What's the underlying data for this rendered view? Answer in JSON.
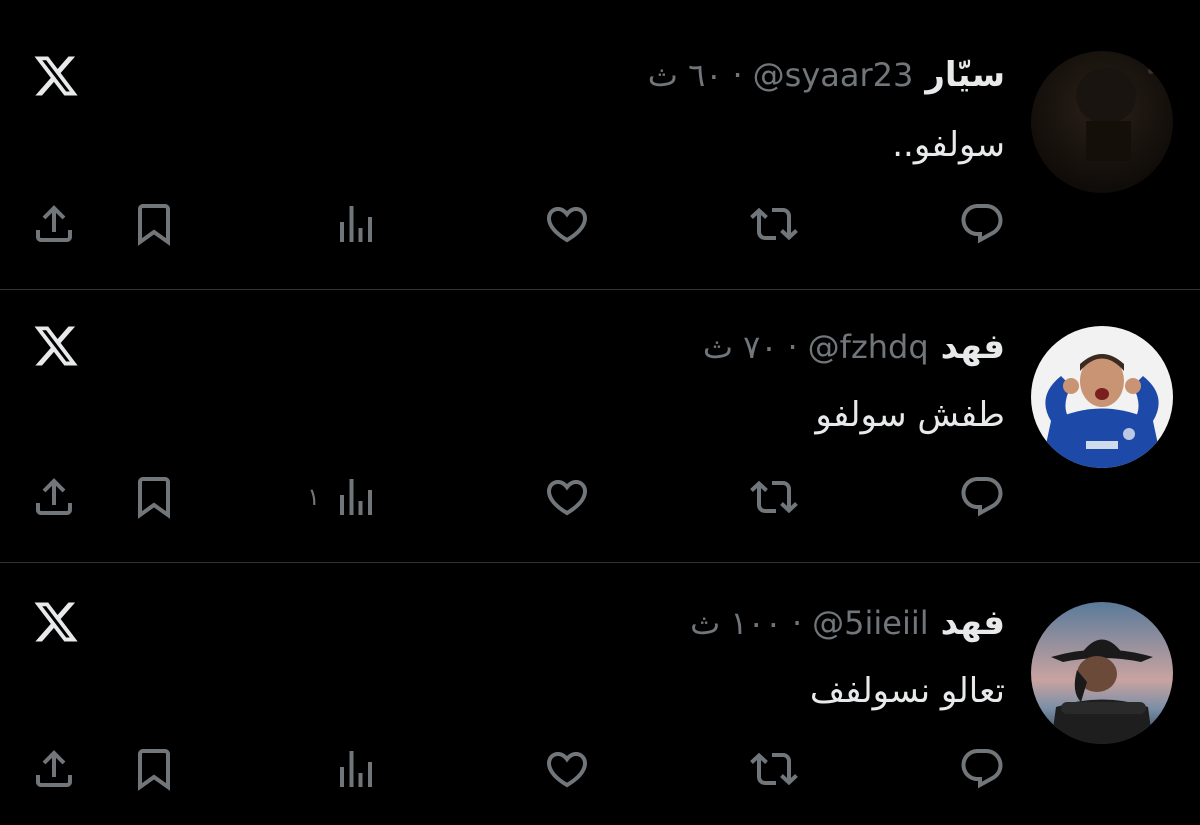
{
  "tweets": [
    {
      "name": "سيّار",
      "handle": "@syaar23",
      "separator": "·",
      "time": "٦٠ ث",
      "text": "سولفو..",
      "views_count": "",
      "avatar": "dark-profile-photo"
    },
    {
      "name": "فهد",
      "handle": "@fzhdq",
      "separator": "·",
      "time": "٧٠ ث",
      "text": "طفش سولفو",
      "views_count": "١",
      "avatar": "footballer-blue-jersey-photo"
    },
    {
      "name": "فهد",
      "handle": "@5iieiil",
      "separator": "·",
      "time": "١٠٠ ث",
      "text": "تعالو نسولفف",
      "views_count": "",
      "avatar": "person-cowboy-hat-photo"
    }
  ],
  "icons": {
    "brand": "x-logo-icon",
    "reply": "reply-icon",
    "repost": "repost-icon",
    "like": "like-icon",
    "views": "views-icon",
    "bookmark": "bookmark-icon",
    "share": "share-icon"
  },
  "colors": {
    "background": "#000000",
    "text": "#e7e9ea",
    "secondary": "#71767b",
    "divider": "#2f3336"
  }
}
